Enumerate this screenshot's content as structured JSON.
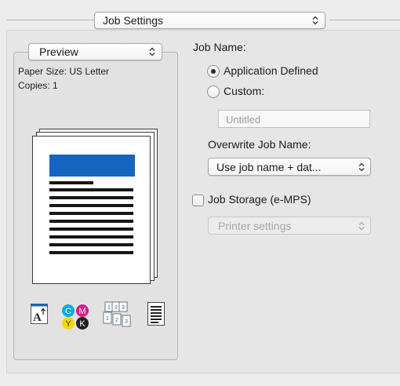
{
  "header": {
    "panel_select": "Job Settings"
  },
  "preview": {
    "mode_select": "Preview",
    "paper_size_label": "Paper Size: US Letter",
    "copies_label": "Copies: 1"
  },
  "icons": {
    "orientation": "orientation-icon",
    "color": "cmyk-color-icon",
    "collate": "collate-pages-icon",
    "document": "document-icon"
  },
  "cmyk_letters": {
    "c": "C",
    "m": "M",
    "y": "Y",
    "k": "K"
  },
  "collate_digits": {
    "a": "1",
    "b": "2",
    "c": "3"
  },
  "job": {
    "name_label": "Job Name:",
    "option_app": "Application Defined",
    "option_custom": "Custom:",
    "custom_placeholder": "Untitled",
    "selected_option": "Application Defined",
    "overwrite_label": "Overwrite Job Name:",
    "overwrite_select": "Use job name + dat...",
    "storage_label": "Job Storage (e-MPS)",
    "storage_checked": false,
    "storage_select": "Printer settings"
  },
  "colors": {
    "accent_blue": "#1565c0",
    "cyan": "#13a8e0",
    "magenta": "#e0198c",
    "yellow": "#f6d800",
    "black": "#222222"
  }
}
